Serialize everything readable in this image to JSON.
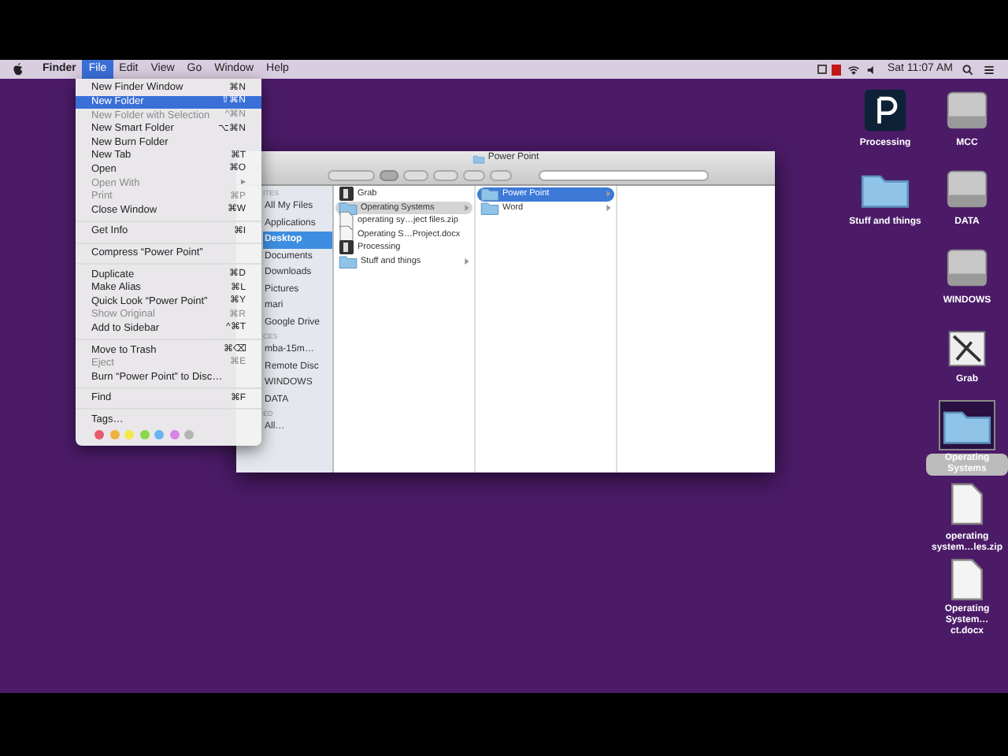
{
  "menu_bar": {
    "items": [
      {
        "kind": "app",
        "label": "Finder",
        "selected": false
      },
      {
        "kind": "menu",
        "label": "File",
        "selected": true
      },
      {
        "kind": "menu",
        "label": "Edit",
        "selected": false
      },
      {
        "kind": "menu",
        "label": "View",
        "selected": false
      },
      {
        "kind": "menu",
        "label": "Go",
        "selected": false
      },
      {
        "kind": "menu",
        "label": "Window",
        "selected": false
      },
      {
        "kind": "menu",
        "label": "Help",
        "selected": false
      }
    ],
    "clock": "Sat 11:07 AM"
  },
  "file_menu": [
    {
      "kind": "item",
      "label": "New Finder Window",
      "shortcut": "⌘N",
      "disabled": false,
      "selected": false
    },
    {
      "kind": "item",
      "label": "New Folder",
      "shortcut": "⇧⌘N",
      "disabled": false,
      "selected": true
    },
    {
      "kind": "item",
      "label": "New Folder with Selection",
      "shortcut": "^⌘N",
      "disabled": true,
      "selected": false
    },
    {
      "kind": "item",
      "label": "New Smart Folder",
      "shortcut": "⌥⌘N",
      "disabled": false,
      "selected": false
    },
    {
      "kind": "item",
      "label": "New Burn Folder",
      "disabled": false,
      "selected": false
    },
    {
      "kind": "item",
      "label": "New Tab",
      "shortcut": "⌘T",
      "disabled": false,
      "selected": false
    },
    {
      "kind": "item",
      "label": "Open",
      "shortcut": "⌘O",
      "disabled": false,
      "selected": false
    },
    {
      "kind": "item",
      "label": "Open With",
      "shortcut": "▸",
      "disabled": true,
      "selected": false
    },
    {
      "kind": "item",
      "label": "Print",
      "shortcut": "⌘P",
      "disabled": true,
      "selected": false
    },
    {
      "kind": "item",
      "label": "Close Window",
      "shortcut": "⌘W",
      "disabled": false,
      "selected": false
    },
    {
      "kind": "separator"
    },
    {
      "kind": "item",
      "label": "Get Info",
      "shortcut": "⌘I",
      "disabled": false,
      "selected": false
    },
    {
      "kind": "separator"
    },
    {
      "kind": "item",
      "label": "Compress “Power Point”",
      "disabled": false,
      "selected": false
    },
    {
      "kind": "separator"
    },
    {
      "kind": "item",
      "label": "Duplicate",
      "shortcut": "⌘D",
      "disabled": false,
      "selected": false
    },
    {
      "kind": "item",
      "label": "Make Alias",
      "shortcut": "⌘L",
      "disabled": false,
      "selected": false
    },
    {
      "kind": "item",
      "label": "Quick Look “Power Point”",
      "shortcut": "⌘Y",
      "disabled": false,
      "selected": false
    },
    {
      "kind": "item",
      "label": "Show Original",
      "shortcut": "⌘R",
      "disabled": true,
      "selected": false
    },
    {
      "kind": "item",
      "label": "Add to Sidebar",
      "shortcut": "^⌘T",
      "disabled": false,
      "selected": false
    },
    {
      "kind": "separator"
    },
    {
      "kind": "item",
      "label": "Move to Trash",
      "shortcut": "⌘⌫",
      "disabled": false,
      "selected": false
    },
    {
      "kind": "item",
      "label": "Eject",
      "shortcut": "⌘E",
      "disabled": true,
      "selected": false
    },
    {
      "kind": "item",
      "label": "Burn “Power Point” to Disc…",
      "disabled": false,
      "selected": false
    },
    {
      "kind": "separator"
    },
    {
      "kind": "item",
      "label": "Find",
      "shortcut": "⌘F",
      "disabled": false,
      "selected": false
    },
    {
      "kind": "separator"
    },
    {
      "kind": "item",
      "label": "Tags…",
      "disabled": false,
      "selected": false
    },
    {
      "kind": "colors",
      "colors": [
        {
          "color": "#e8596a"
        },
        {
          "color": "#f0b03c"
        },
        {
          "color": "#f2e84a"
        },
        {
          "color": "#8ad84a"
        },
        {
          "color": "#6ab4f0"
        },
        {
          "color": "#d884e6"
        },
        {
          "color": "#b4b4b4"
        }
      ]
    }
  ],
  "finder_window": {
    "title": "Power Point",
    "sidebar": [
      {
        "kind": "header",
        "label": "ITES"
      },
      {
        "kind": "item",
        "label": "All My Files",
        "selected": false
      },
      {
        "kind": "item",
        "label": "Applications",
        "selected": false
      },
      {
        "kind": "item",
        "label": "Desktop",
        "selected": true
      },
      {
        "kind": "item",
        "label": "Documents",
        "selected": false
      },
      {
        "kind": "item",
        "label": "Downloads",
        "selected": false
      },
      {
        "kind": "item",
        "label": "Pictures",
        "selected": false
      },
      {
        "kind": "item",
        "label": "mari",
        "selected": false
      },
      {
        "kind": "item",
        "label": "Google Drive",
        "selected": false
      },
      {
        "kind": "header",
        "label": "CES"
      },
      {
        "kind": "item",
        "label": "mba-15m…",
        "selected": false
      },
      {
        "kind": "item",
        "label": "Remote Disc",
        "selected": false
      },
      {
        "kind": "item",
        "label": "WINDOWS",
        "selected": false
      },
      {
        "kind": "item",
        "label": "DATA",
        "selected": false
      },
      {
        "kind": "header",
        "label": "ED"
      },
      {
        "kind": "item",
        "label": "All…",
        "selected": false
      }
    ],
    "columns": [
      {
        "focused": false,
        "items": [
          {
            "label": "Grab",
            "kind": "app",
            "selected": false,
            "has_children": false
          },
          {
            "label": "Operating Systems",
            "kind": "folder",
            "selected": true,
            "has_children": true
          },
          {
            "label": "operating sy…ject files.zip",
            "kind": "file",
            "selected": false,
            "has_children": false
          },
          {
            "label": "Operating S…Project.docx",
            "kind": "file",
            "selected": false,
            "has_children": false
          },
          {
            "label": "Processing",
            "kind": "app",
            "selected": false,
            "has_children": false
          },
          {
            "label": "Stuff and things",
            "kind": "folder",
            "selected": false,
            "has_children": true
          }
        ]
      },
      {
        "focused": true,
        "items": [
          {
            "label": "Power Point",
            "kind": "folder",
            "selected": true,
            "has_children": true
          },
          {
            "label": "Word",
            "kind": "folder",
            "selected": false,
            "has_children": true
          }
        ]
      }
    ]
  },
  "desktop": {
    "columns": [
      [
        {
          "label": "Processing",
          "kind": "app",
          "selected": false
        },
        {
          "label": "Stuff and things",
          "kind": "folder",
          "selected": false
        }
      ],
      [
        {
          "label": "MCC",
          "kind": "drive",
          "selected": false
        },
        {
          "label": "DATA",
          "kind": "drive",
          "selected": false
        },
        {
          "label": "WINDOWS",
          "kind": "drive",
          "selected": false
        },
        {
          "label": "Grab",
          "kind": "grab",
          "selected": false
        },
        {
          "label": "Operating Systems",
          "kind": "folder",
          "selected": true
        },
        {
          "label": "operating system…les.zip",
          "kind": "file",
          "selected": false
        },
        {
          "label": "Operating System…ct.docx",
          "kind": "file",
          "selected": false
        }
      ]
    ]
  }
}
